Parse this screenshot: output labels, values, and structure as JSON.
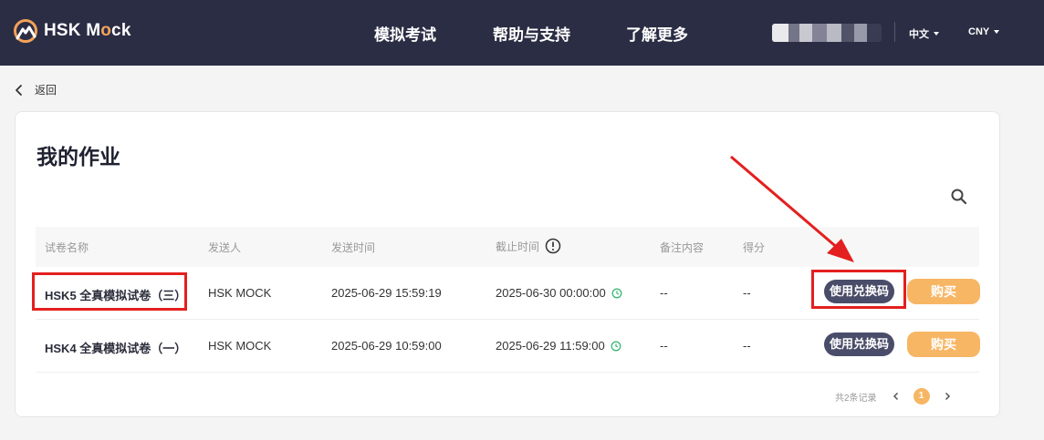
{
  "header": {
    "brand": {
      "text_a": "HSK M",
      "text_o": "o",
      "text_b": "ck"
    },
    "nav": [
      "模拟考试",
      "帮助与支持",
      "了解更多"
    ],
    "language": "中文",
    "currency": "CNY"
  },
  "back_label": "返回",
  "page_title": "我的作业",
  "table": {
    "columns": [
      "试卷名称",
      "发送人",
      "发送时间",
      "截止时间",
      "备注内容",
      "得分"
    ],
    "rows": [
      {
        "name": "HSK5 全真模拟试卷（三）",
        "sender": "HSK MOCK",
        "sent_time": "2025-06-29 15:59:19",
        "deadline": "2025-06-30 00:00:00",
        "remark": "--",
        "score": "--",
        "redeem_label": "使用兑换码",
        "buy_label": "购买"
      },
      {
        "name": "HSK4 全真模拟试卷（一）",
        "sender": "HSK MOCK",
        "sent_time": "2025-06-29 10:59:00",
        "deadline": "2025-06-29 11:59:00",
        "remark": "--",
        "score": "--",
        "redeem_label": "使用兑换码",
        "buy_label": "购买"
      }
    ]
  },
  "pagination": {
    "total_text": "共2条记录",
    "current_page": "1"
  },
  "colors": {
    "header_bg": "#2b2d44",
    "accent": "#f7b664",
    "redeem_bg": "#4a4d69",
    "annotation": "#e41f1f"
  },
  "icons": [
    "logo-mountain-icon",
    "chevron-left-icon",
    "search-icon",
    "info-circle-icon",
    "clock-icon",
    "chevron-right-icon"
  ]
}
